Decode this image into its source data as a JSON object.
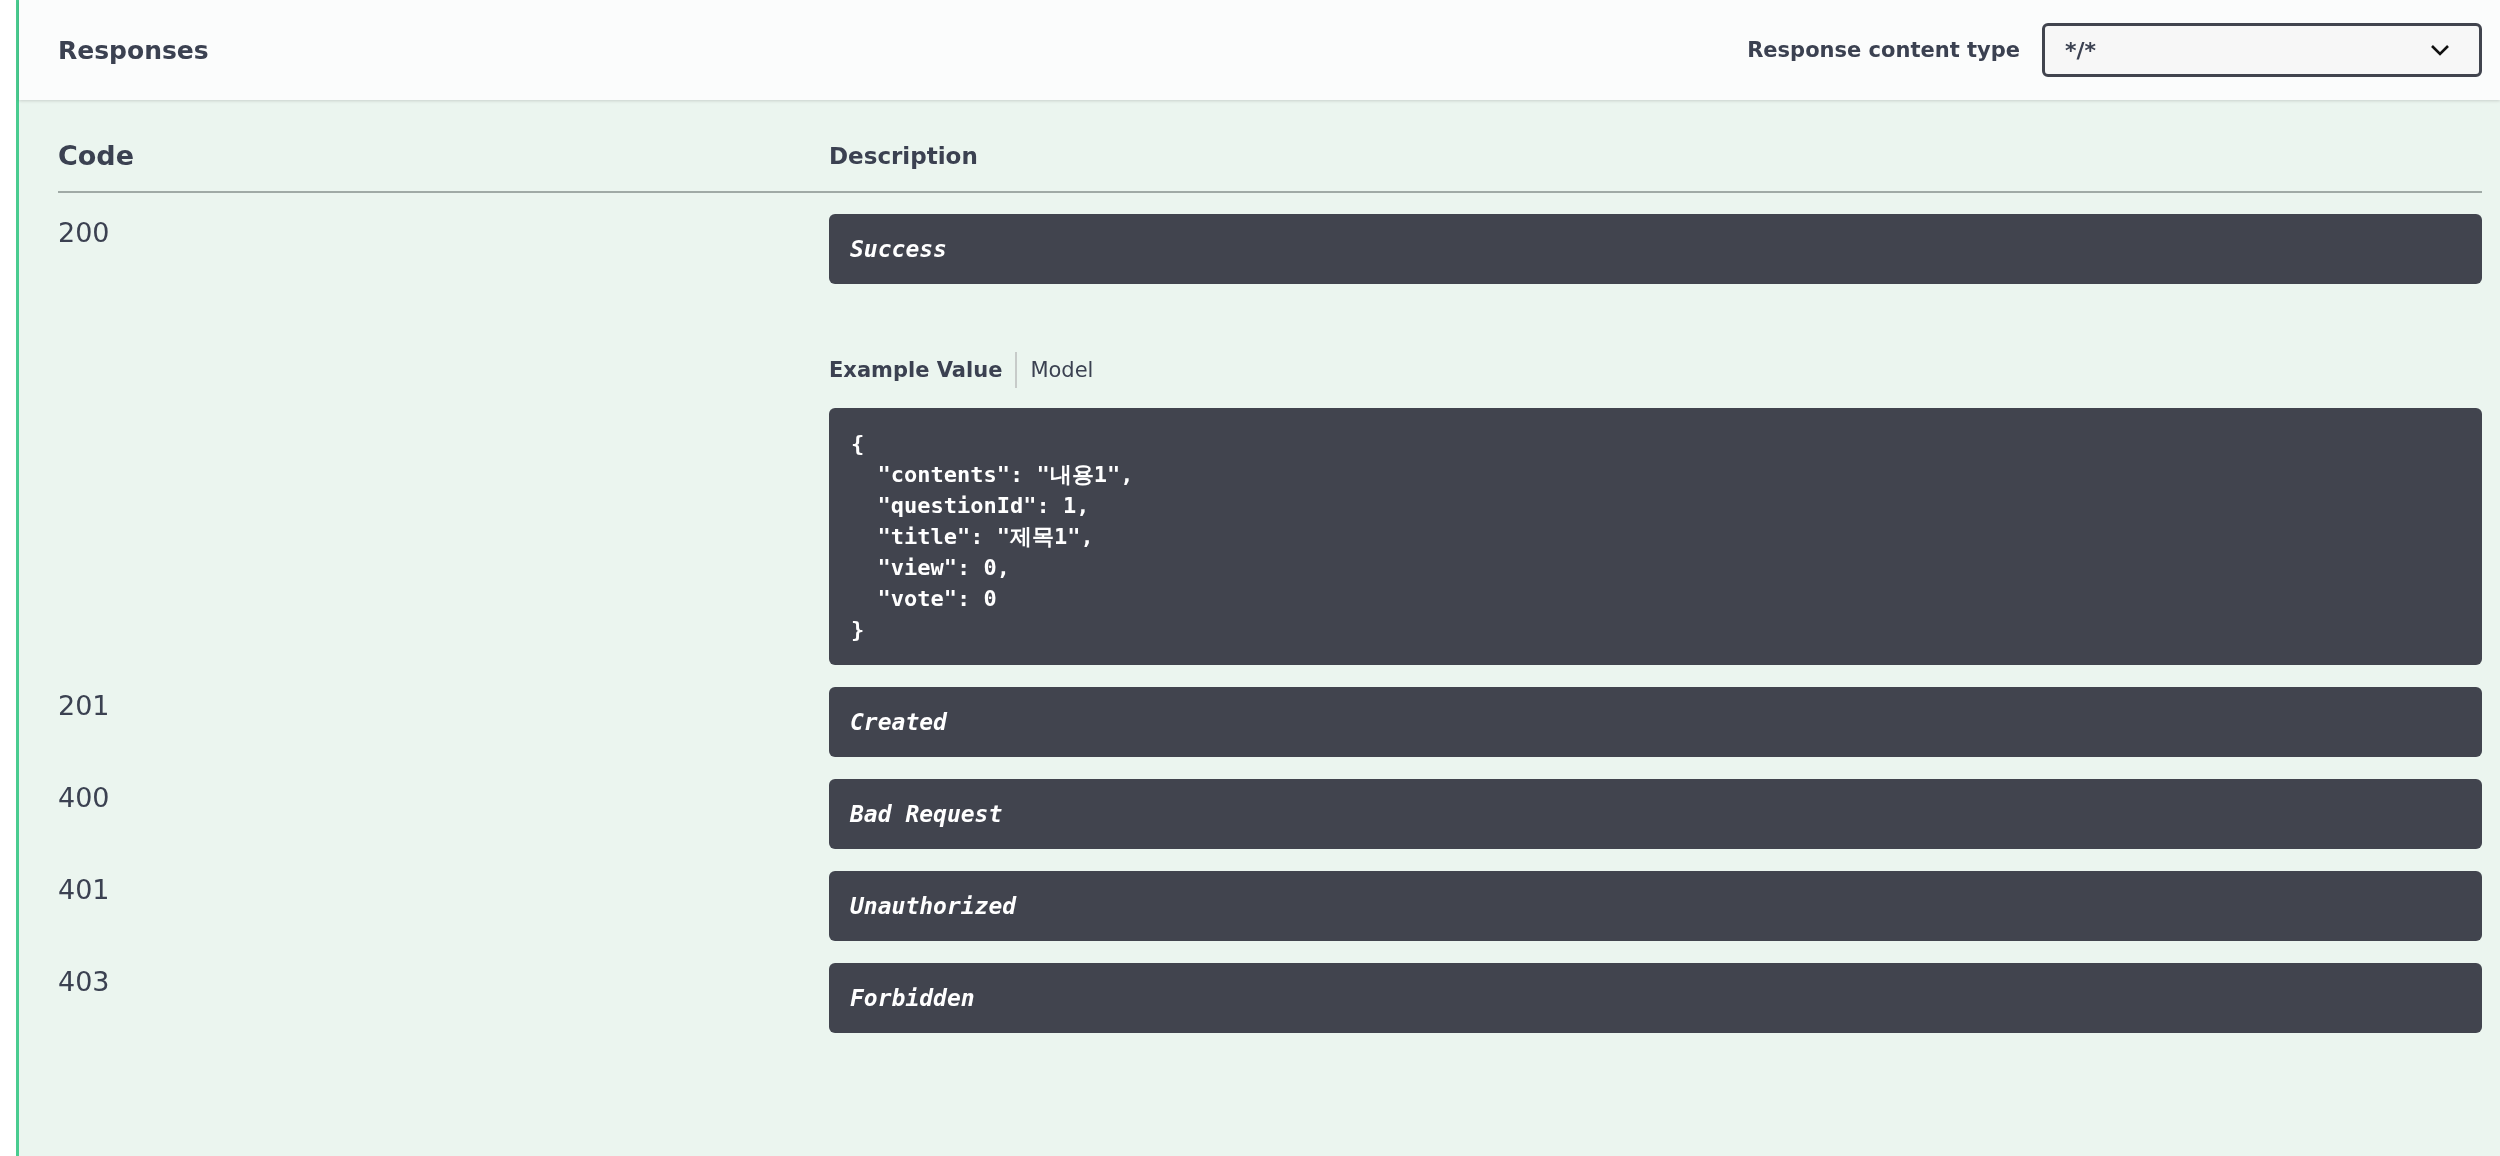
{
  "header": {
    "title": "Responses",
    "content_type_label": "Response content type",
    "content_type_value": "*/*"
  },
  "table": {
    "columns": [
      "Code",
      "Description"
    ],
    "rows": [
      {
        "code": "200",
        "description": "Success",
        "example": {
          "tabs": [
            {
              "label": "Example Value",
              "selected": true
            },
            {
              "label": "Model",
              "selected": false
            }
          ],
          "lines": [
            "{",
            "  \"contents\": \"내용1\",",
            "  \"questionId\": 1,",
            "  \"title\": \"제목1\",",
            "  \"view\": 0,",
            "  \"vote\": 0",
            "}"
          ]
        }
      },
      {
        "code": "201",
        "description": "Created"
      },
      {
        "code": "400",
        "description": "Bad Request"
      },
      {
        "code": "401",
        "description": "Unauthorized"
      },
      {
        "code": "403",
        "description": "Forbidden"
      }
    ]
  }
}
